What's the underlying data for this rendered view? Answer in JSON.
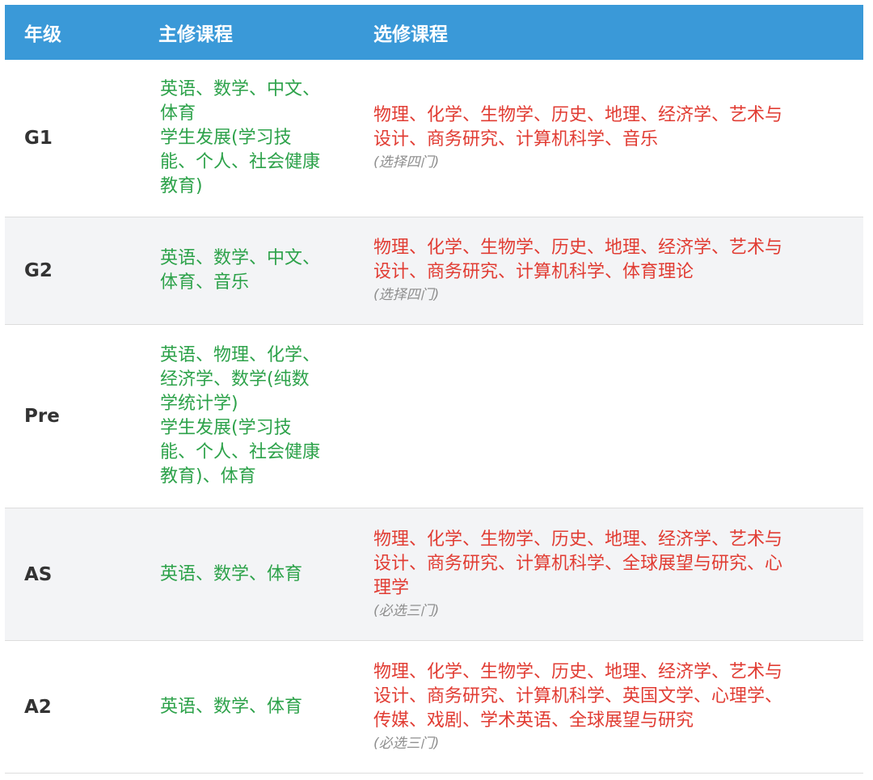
{
  "table": {
    "headers": {
      "grade": "年级",
      "main": "主修课程",
      "elective": "选修课程"
    },
    "rows": [
      {
        "grade": "G1",
        "main_lines": [
          "英语、数学、中文、",
          "体育",
          "学生发展(学习技",
          "能、个人、社会健康",
          "教育)"
        ],
        "elective_lines": [
          "物理、化学、生物学、历史、地理、经济学、艺术与",
          "设计、商务研究、计算机科学、音乐"
        ],
        "note": "(选择四门)"
      },
      {
        "grade": "G2",
        "main_lines": [
          "英语、数学、中文、",
          "体育、音乐"
        ],
        "elective_lines": [
          "物理、化学、生物学、历史、地理、经济学、艺术与",
          "设计、商务研究、计算机科学、体育理论"
        ],
        "note": "(选择四门)"
      },
      {
        "grade": "Pre",
        "main_lines": [
          "英语、物理、化学、",
          "经济学、数学(纯数",
          "学统计学)",
          "学生发展(学习技",
          "能、个人、社会健康",
          "教育)、体育"
        ],
        "elective_lines": [],
        "note": ""
      },
      {
        "grade": "AS",
        "main_lines": [
          "英语、数学、体育"
        ],
        "elective_lines": [
          "物理、化学、生物学、历史、地理、经济学、艺术与",
          "设计、商务研究、计算机科学、全球展望与研究、心",
          "理学"
        ],
        "note": "(必选三门)"
      },
      {
        "grade": "A2",
        "main_lines": [
          "英语、数学、体育"
        ],
        "elective_lines": [
          "物理、化学、生物学、历史、地理、经济学、艺术与",
          "设计、商务研究、计算机科学、英国文学、心理学、",
          "传媒、戏剧、学术英语、全球展望与研究"
        ],
        "note": "(必选三门)"
      }
    ]
  }
}
